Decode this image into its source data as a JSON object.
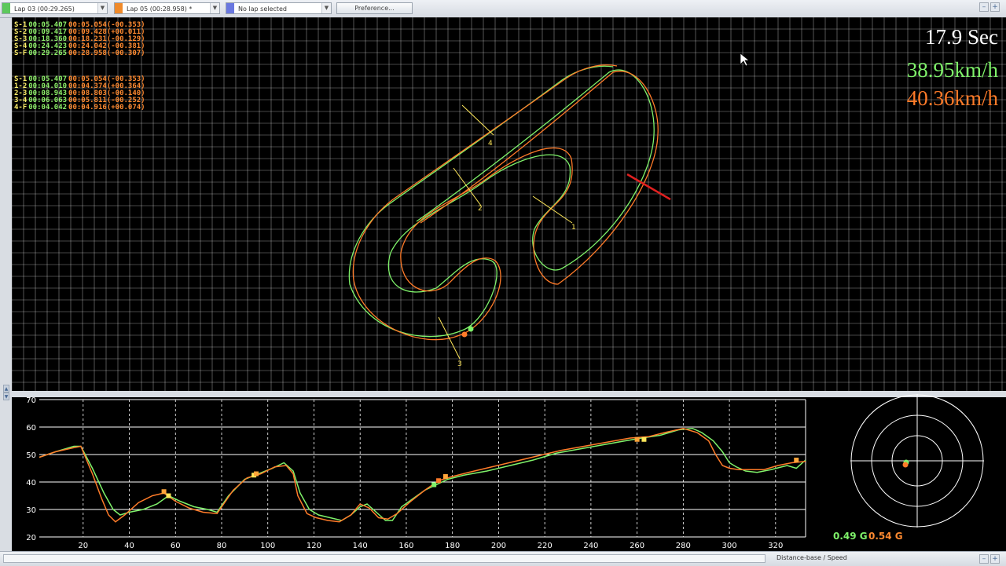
{
  "toolbar": {
    "lap1": {
      "label": "Lap 03  (00:29.265)",
      "color": "#5cc85c"
    },
    "lap2": {
      "label": "Lap 05  (00:28.958) *",
      "color": "#f08a2a"
    },
    "lap3": {
      "label": "No lap selected",
      "color": "#6a78e0"
    },
    "preference_label": "Preference...",
    "window_buttons": [
      "–",
      "+"
    ]
  },
  "sector_times": [
    {
      "label": "S-1",
      "lap_a": "00:05.407",
      "lap_b": "00:05.054(-00.353)"
    },
    {
      "label": "S-2",
      "lap_a": "00:09.417",
      "lap_b": "00:09.428(+00.011)"
    },
    {
      "label": "S-3",
      "lap_a": "00:18.360",
      "lap_b": "00:18.231(-00.129)"
    },
    {
      "label": "S-4",
      "lap_a": "00:24.423",
      "lap_b": "00:24.042(-00.381)"
    },
    {
      "label": "S-F",
      "lap_a": "00:29.265",
      "lap_b": "00:28.958(-00.307)"
    }
  ],
  "split_times": [
    {
      "label": "S-1",
      "lap_a": "00:05.407",
      "lap_b": "00:05.054(-00.353)"
    },
    {
      "label": "1-2",
      "lap_a": "00:04.010",
      "lap_b": "00:04.374(+00.364)"
    },
    {
      "label": "2-3",
      "lap_a": "00:08.943",
      "lap_b": "00:08.803(-00.140)"
    },
    {
      "label": "3-4",
      "lap_a": "00:06.063",
      "lap_b": "00:05.811(-00.252)"
    },
    {
      "label": "4-F",
      "lap_a": "00:04.042",
      "lap_b": "00:04.916(+00.074)"
    }
  ],
  "overlay": {
    "elapsed": "17.9 Sec",
    "speed_lap_a": "38.95km/h",
    "speed_lap_b": "40.36km/h"
  },
  "track_markers": [
    "1",
    "2",
    "3",
    "4"
  ],
  "gforce": {
    "lap_a": "0.49 G",
    "lap_b": "0.54 G"
  },
  "status": {
    "mode": "Distance-base / Speed"
  },
  "colors": {
    "lap_a": "#7ff26a",
    "lap_b": "#ff7b29",
    "marker": "#ffe85a",
    "grid": "#ffffff"
  },
  "chart_data": {
    "type": "line",
    "xlabel": "",
    "ylabel": "",
    "xlim": [
      1,
      333
    ],
    "ylim": [
      20,
      70
    ],
    "x_ticks": [
      20,
      40,
      60,
      80,
      100,
      120,
      140,
      160,
      180,
      200,
      220,
      240,
      260,
      280,
      300,
      320
    ],
    "y_ticks": [
      20,
      30,
      40,
      50,
      60,
      70
    ],
    "grid": true,
    "series": [
      {
        "color": "#7ff26a",
        "x": [
          1,
          8,
          16,
          19,
          24,
          29,
          33,
          36,
          40,
          46,
          52,
          57,
          62,
          68,
          74,
          78,
          83,
          90,
          96,
          102,
          107,
          111,
          114,
          118,
          122,
          127,
          132,
          136,
          140,
          143,
          147,
          151,
          154,
          158,
          163,
          168,
          173,
          178,
          185,
          195,
          205,
          215,
          225,
          235,
          245,
          255,
          262,
          270,
          278,
          284,
          288,
          293,
          297,
          300,
          303,
          307,
          312,
          318,
          325,
          329,
          333
        ],
        "y": [
          49,
          51,
          53,
          53,
          45,
          36,
          30,
          28,
          29,
          30,
          32,
          35,
          33,
          31,
          30,
          29,
          35,
          41,
          43,
          45,
          47,
          44,
          36,
          30,
          28,
          27,
          26,
          28,
          31,
          32,
          29,
          26,
          26,
          31,
          34,
          37,
          39,
          41,
          42.5,
          44,
          46,
          48,
          50.5,
          52,
          53.5,
          55,
          56,
          57,
          59,
          59.5,
          58,
          55,
          51,
          47,
          45.5,
          44,
          43.5,
          44.5,
          46,
          45,
          48
        ]
      },
      {
        "color": "#ff7b29",
        "x": [
          1,
          8,
          16,
          19,
          24,
          28,
          31,
          34,
          38,
          44,
          50,
          55,
          60,
          66,
          72,
          78,
          85,
          91,
          97,
          103,
          108,
          111,
          113,
          117,
          121,
          126,
          131,
          136,
          140,
          144,
          148,
          152,
          156,
          162,
          168,
          174,
          180,
          187,
          197,
          207,
          217,
          227,
          237,
          247,
          257,
          265,
          272,
          280,
          286,
          291,
          294,
          297,
          300,
          304,
          309,
          315,
          321,
          327,
          333
        ],
        "y": [
          49,
          51,
          52.5,
          53,
          43,
          34,
          28,
          25.5,
          28,
          32.5,
          35,
          36,
          33,
          30.5,
          29,
          28.5,
          37,
          41.5,
          43,
          45.5,
          46,
          43,
          35,
          28.5,
          27,
          26,
          25.5,
          28,
          32,
          30.5,
          27,
          26.5,
          28.5,
          33,
          37,
          40.5,
          42,
          43.5,
          45.5,
          47.5,
          49.5,
          51.5,
          53,
          54.5,
          56,
          56.5,
          58,
          59.5,
          58,
          55,
          50,
          46,
          45,
          44.5,
          44.5,
          44.5,
          46,
          47,
          47.5
        ]
      }
    ],
    "markers": [
      {
        "x": 55,
        "y": 36.5,
        "color": "#ffa53a"
      },
      {
        "x": 57,
        "y": 35,
        "color": "#ffe85a"
      },
      {
        "x": 94,
        "y": 42.5,
        "color": "#ffe85a"
      },
      {
        "x": 95,
        "y": 43,
        "color": "#ffa53a"
      },
      {
        "x": 172,
        "y": 39,
        "color": "#7ff26a"
      },
      {
        "x": 174,
        "y": 40.5,
        "color": "#ff7b29"
      },
      {
        "x": 177,
        "y": 42,
        "color": "#ffa53a"
      },
      {
        "x": 260,
        "y": 55.5,
        "color": "#ffa53a"
      },
      {
        "x": 263,
        "y": 55.5,
        "color": "#ffe85a"
      },
      {
        "x": 329,
        "y": 48,
        "color": "#ffa53a"
      }
    ]
  }
}
